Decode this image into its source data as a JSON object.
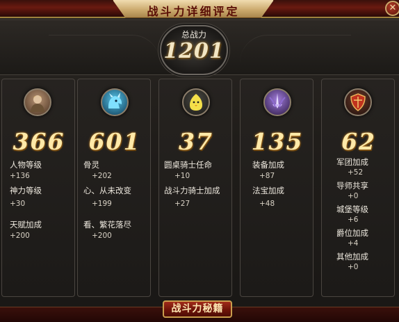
{
  "window": {
    "title": "战斗力详细评定",
    "close_glyph": "✕"
  },
  "summary": {
    "label": "总战力",
    "value": "1201"
  },
  "columns": [
    {
      "icon": "knight-portrait-icon",
      "value": "366",
      "stats": [
        {
          "name": "人物等级",
          "value": "+136"
        },
        {
          "name": "神力等级",
          "value": "+30"
        },
        {
          "name": "天赋加成",
          "value": "+200"
        }
      ]
    },
    {
      "icon": "dragon-head-icon",
      "value": "601",
      "stats": [
        {
          "name": "骨灵",
          "value": "+202"
        },
        {
          "name": "心、从未改变",
          "value": "+199"
        },
        {
          "name": "看、繁花落尽",
          "value": "+200"
        }
      ]
    },
    {
      "icon": "yellow-chick-icon",
      "value": "37",
      "stats": [
        {
          "name": "圆桌骑士任命",
          "value": "+10"
        },
        {
          "name": "战斗力骑士加成",
          "value": "+27"
        }
      ]
    },
    {
      "icon": "purple-sword-emblem-icon",
      "value": "135",
      "stats": [
        {
          "name": "装备加成",
          "value": "+87"
        },
        {
          "name": "法宝加成",
          "value": "+48"
        }
      ]
    },
    {
      "icon": "red-shield-icon",
      "value": "62",
      "stats": [
        {
          "name": "军团加成",
          "value": "+52"
        },
        {
          "name": "导师共享",
          "value": "+0"
        },
        {
          "name": "城堡等级",
          "value": "+6"
        },
        {
          "name": "爵位加成",
          "value": "+4"
        },
        {
          "name": "其他加成",
          "value": "+0"
        }
      ]
    }
  ],
  "footer": {
    "button_label": "战斗力秘籍"
  },
  "colors": {
    "title_text": "#5a0e06",
    "gold_numbers": "#ffe9a8",
    "panel_bg": "#201d1a",
    "button_red": "#6e1409"
  }
}
